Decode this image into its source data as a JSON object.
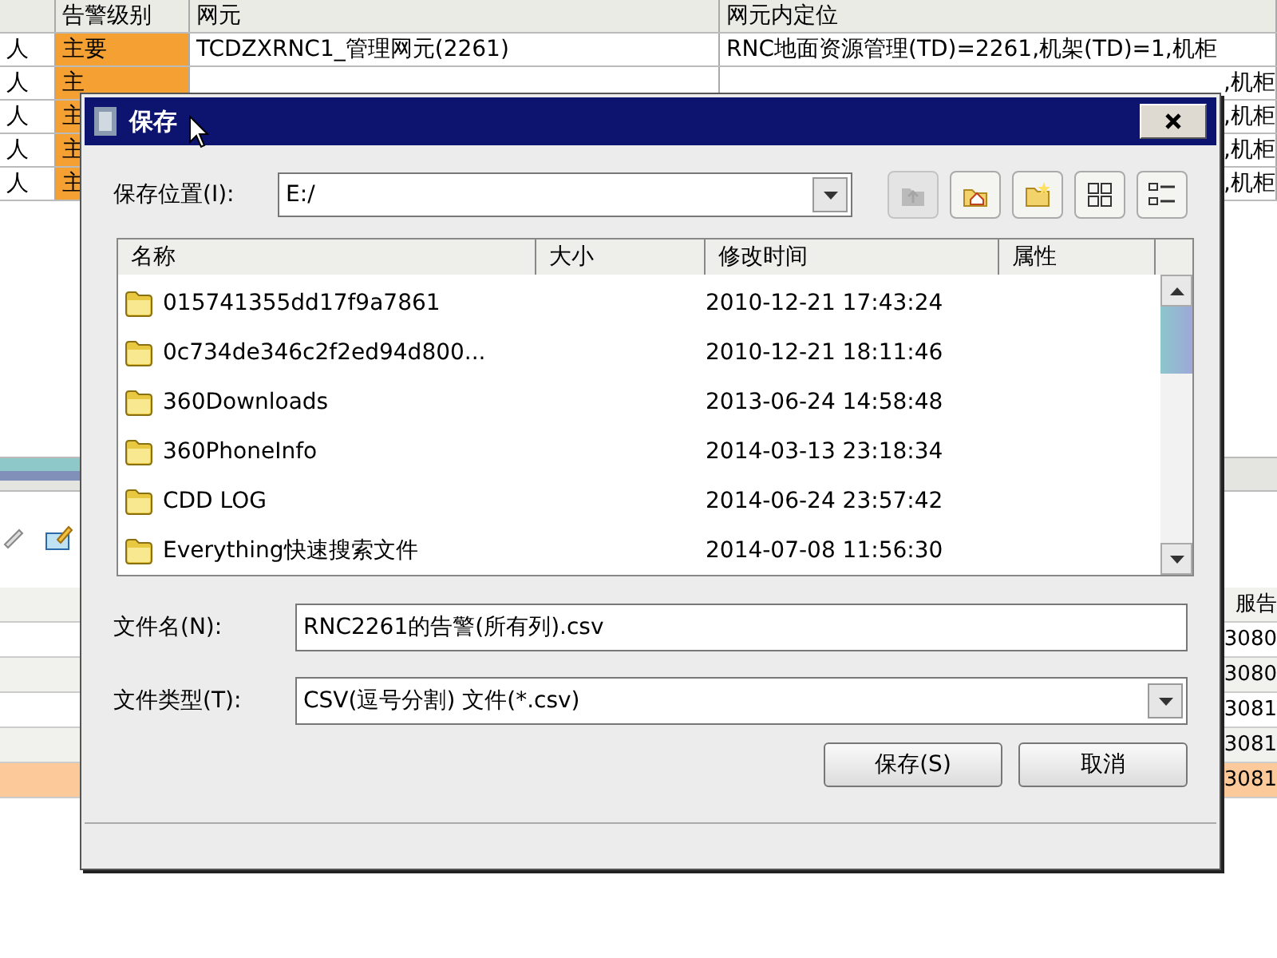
{
  "alarm_table": {
    "columns": [
      "",
      "告警级别",
      "网元",
      "网元内定位"
    ],
    "rows": [
      {
        "col_1": "人",
        "level": "主要",
        "element": "TCDZXRNC1_管理网元(2261)",
        "location": "RNC地面资源管理(TD)=2261,机架(TD)=1,机柜"
      },
      {
        "col_1": "人",
        "level": "主",
        "element": "",
        "location": ",机柜"
      },
      {
        "col_1": "人",
        "level": "主",
        "element": "",
        "location": ",机柜"
      },
      {
        "col_1": "人",
        "level": "主",
        "element": "",
        "location": ",机柜"
      },
      {
        "col_1": "人",
        "level": "主",
        "element": "",
        "location": ",机柜"
      }
    ]
  },
  "lower_table": {
    "column_heading": "服告",
    "rows": [
      {
        "text": "3080",
        "selected": false
      },
      {
        "text": "3080",
        "selected": false
      },
      {
        "text": "3081",
        "selected": false
      },
      {
        "text": "3081",
        "selected": false
      },
      {
        "text": "3081",
        "selected": true
      }
    ]
  },
  "dialog": {
    "title": "保存",
    "look_in_label": "保存位置(I):",
    "look_in_value": "E:/",
    "tools": [
      {
        "kind": "up",
        "disabled": true
      },
      {
        "kind": "home",
        "disabled": false
      },
      {
        "kind": "new-folder",
        "disabled": false
      },
      {
        "kind": "list",
        "disabled": false
      },
      {
        "kind": "details",
        "disabled": false
      }
    ],
    "columns": [
      "名称",
      "大小",
      "修改时间",
      "属性"
    ],
    "files": [
      {
        "name": "015741355dd17f9a7861",
        "modified": "2010-12-21 17:43:24"
      },
      {
        "name": "0c734de346c2f2ed94d800...",
        "modified": "2010-12-21 18:11:46"
      },
      {
        "name": "360Downloads",
        "modified": "2013-06-24 14:58:48"
      },
      {
        "name": "360PhoneInfo",
        "modified": "2014-03-13 23:18:34"
      },
      {
        "name": "CDD LOG",
        "modified": "2014-06-24 23:57:42"
      },
      {
        "name": "Everything快速搜索文件",
        "modified": "2014-07-08 11:56:30"
      }
    ],
    "file_name_label": "文件名(N):",
    "file_name": "RNC2261的告警(所有列).csv",
    "file_type_label": "文件类型(T):",
    "file_type": "CSV(逗号分割) 文件(*.csv)",
    "buttons": [
      "保存(S)",
      "取消"
    ]
  }
}
